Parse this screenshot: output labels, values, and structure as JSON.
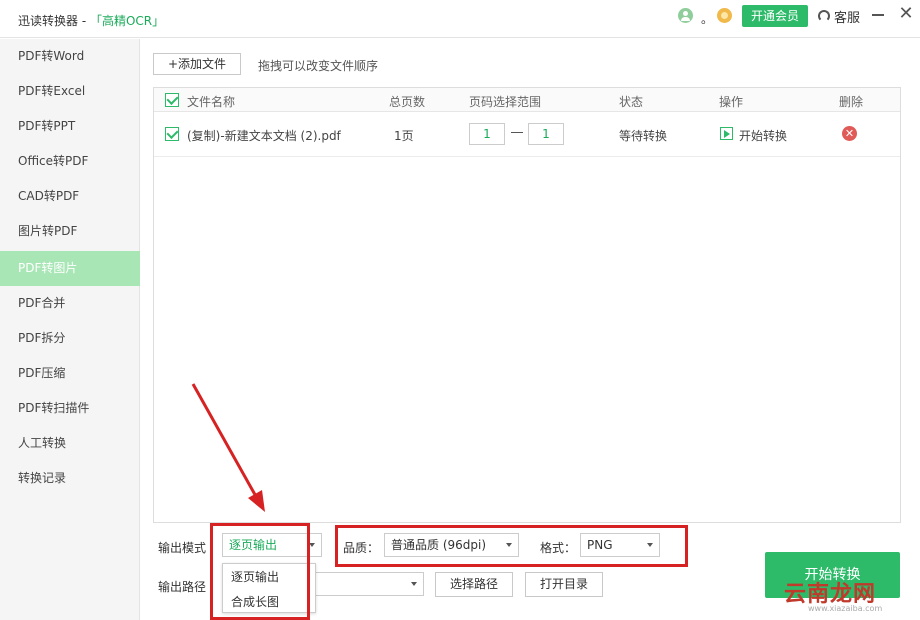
{
  "titlebar": {
    "app_name": "迅读转换器 - ",
    "ocr_link": "「高精OCR」",
    "user_name": "。",
    "vip_button": "开通会员",
    "service_label": "客服",
    "minimize_glyph": "—",
    "close_glyph": "✕"
  },
  "sidebar": {
    "items": [
      {
        "label": "PDF转Word"
      },
      {
        "label": "PDF转Excel"
      },
      {
        "label": "PDF转PPT"
      },
      {
        "label": "Office转PDF"
      },
      {
        "label": "CAD转PDF"
      },
      {
        "label": "图片转PDF"
      },
      {
        "label": "PDF转图片",
        "active": true
      },
      {
        "label": "PDF合并"
      },
      {
        "label": "PDF拆分"
      },
      {
        "label": "PDF压缩"
      },
      {
        "label": "PDF转扫描件"
      },
      {
        "label": "人工转换"
      },
      {
        "label": "转换记录"
      }
    ]
  },
  "toolbar": {
    "add_file": "+添加文件",
    "hint": "拖拽可以改变文件顺序"
  },
  "table": {
    "headers": {
      "name": "文件名称",
      "pages": "总页数",
      "range": "页码选择范围",
      "status": "状态",
      "action": "操作",
      "delete": "删除"
    },
    "rows": [
      {
        "name": "(复制)-新建文本文档 (2).pdf",
        "pages": "1页",
        "range_from": "1",
        "range_to": "1",
        "status": "等待转换",
        "action": "开始转换"
      }
    ]
  },
  "bottom": {
    "output_mode_label": "输出模式",
    "output_mode_value": "逐页输出",
    "quality_label": "品质：",
    "quality_value": "普通品质 (96dpi)",
    "format_label": "格式：",
    "format_value": "PNG",
    "output_path_label": "输出路径",
    "choose_path": "选择路径",
    "open_dir": "打开目录",
    "start_button": "开始转换",
    "dropdown_options": [
      "逐页输出",
      "合成长图"
    ]
  },
  "watermark": {
    "text": "云南龙网",
    "sub": "www.xiazaiba.com"
  },
  "colors": {
    "accent": "#2dbb6a",
    "sidebar_active": "#a9e6b6",
    "annotation_red": "#d62222",
    "delete_red": "#e05a57"
  }
}
